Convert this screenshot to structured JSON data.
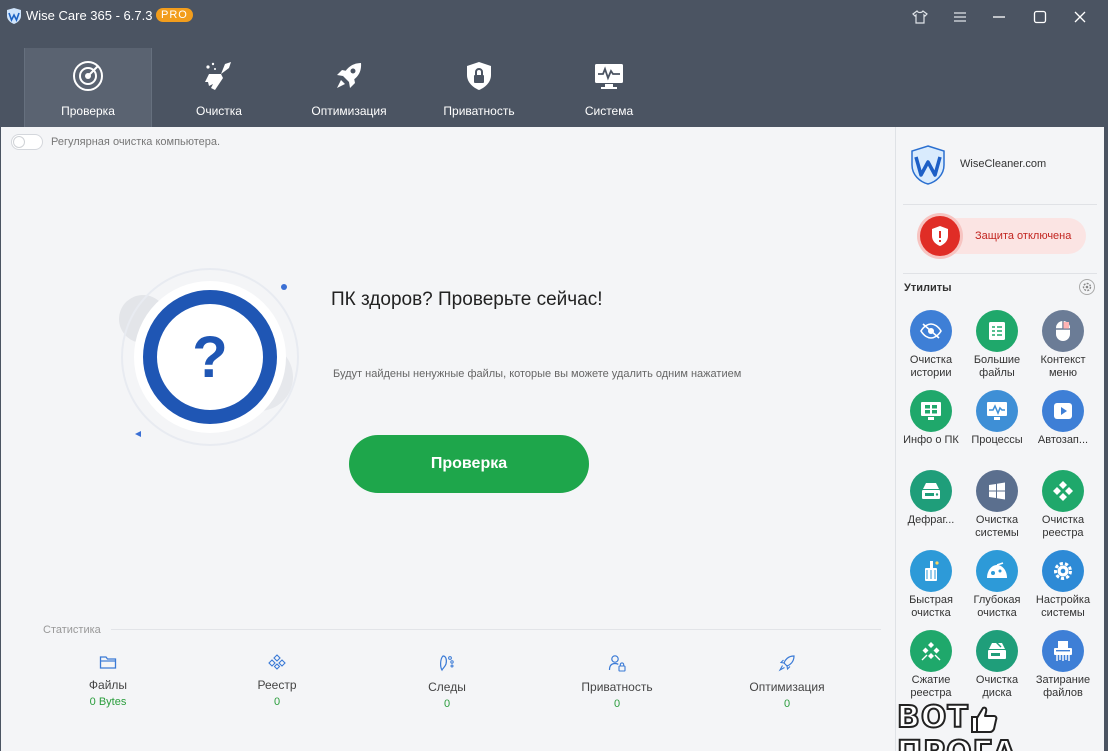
{
  "window": {
    "title": "Wise Care 365 - 6.7.3",
    "badge": "PRO"
  },
  "nav": {
    "tabs": [
      {
        "label": "Проверка",
        "icon": "radar-icon",
        "active": true
      },
      {
        "label": "Очистка",
        "icon": "broom-icon",
        "active": false
      },
      {
        "label": "Оптимизация",
        "icon": "rocket-icon",
        "active": false
      },
      {
        "label": "Приватность",
        "icon": "shield-lock-icon",
        "active": false
      },
      {
        "label": "Система",
        "icon": "monitor-icon",
        "active": false
      }
    ]
  },
  "main": {
    "toggle_label": "Регулярная очистка компьютера.",
    "toggle_on": false,
    "headline": "ПК здоров? Проверьте сейчас!",
    "subtext": "Будут найдены ненужные файлы, которые вы можете удалить одним нажатием",
    "scan_button": "Проверка",
    "accent_color": "#1ea64b"
  },
  "stats": {
    "title": "Статистика",
    "items": [
      {
        "label": "Файлы",
        "value": "0 Bytes",
        "icon": "folder-icon"
      },
      {
        "label": "Реестр",
        "value": "0",
        "icon": "registry-icon"
      },
      {
        "label": "Следы",
        "value": "0",
        "icon": "footprints-icon"
      },
      {
        "label": "Приватность",
        "value": "0",
        "icon": "user-lock-icon"
      },
      {
        "label": "Оптимизация",
        "value": "0",
        "icon": "rocket-icon"
      }
    ]
  },
  "sidebar": {
    "brand": "WiseCleaner.com",
    "protection_status": "Защита отключена",
    "utilities_title": "Утилиты",
    "tools": [
      {
        "label": "Очистка\nистории",
        "icon": "eye-off-icon",
        "color": "#3e7fd6"
      },
      {
        "label": "Большие\nфайлы",
        "icon": "files-icon",
        "color": "#1fa86b"
      },
      {
        "label": "Контекст\nменю",
        "icon": "mouse-icon",
        "color": "#6b7c96"
      },
      {
        "label": "Инфо о ПК",
        "icon": "pc-info-icon",
        "color": "#1fa86b"
      },
      {
        "label": "Процессы",
        "icon": "process-monitor-icon",
        "color": "#3e8fd6"
      },
      {
        "label": "Автозап...",
        "icon": "play-icon",
        "color": "#3e7fd6"
      },
      {
        "label": "Дефраг...",
        "icon": "defrag-icon",
        "color": "#1f9e7a"
      },
      {
        "label": "Очистка\nсистемы",
        "icon": "windows-icon",
        "color": "#5b6f8e"
      },
      {
        "label": "Очистка\nреестра",
        "icon": "registry-clean-icon",
        "color": "#1fa86b"
      },
      {
        "label": "Быстрая\nочистка",
        "icon": "quick-clean-icon",
        "color": "#2d9ad8"
      },
      {
        "label": "Глубокая\nочистка",
        "icon": "deep-clean-icon",
        "color": "#2d9ad8"
      },
      {
        "label": "Настройка\nсистемы",
        "icon": "gear-icon",
        "color": "#2d8ad6"
      },
      {
        "label": "Сжатие\nреестра",
        "icon": "registry-compress-icon",
        "color": "#1fa86b"
      },
      {
        "label": "Очистка\nдиска",
        "icon": "disk-clean-icon",
        "color": "#1f9e7a"
      },
      {
        "label": "Затирание\nфайлов",
        "icon": "shredder-icon",
        "color": "#3e7fd6"
      }
    ]
  },
  "watermark": {
    "left": "BOT",
    "right": "ПРОГА"
  }
}
